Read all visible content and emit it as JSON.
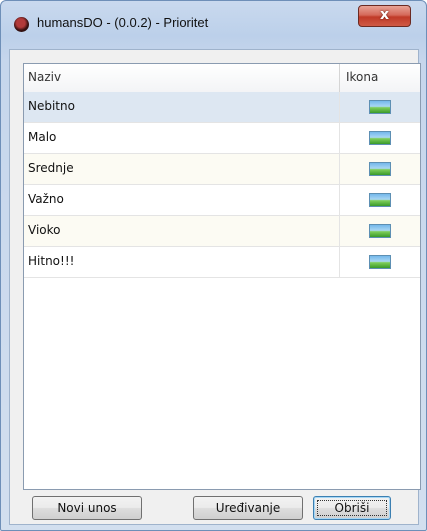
{
  "window": {
    "title": "humansDO - (0.0.2) - Prioritet",
    "close_label": "x"
  },
  "grid": {
    "columns": [
      "Naziv",
      "Ikona"
    ],
    "rows": [
      {
        "name": "Nebitno",
        "icon": "image-icon",
        "selected": true
      },
      {
        "name": "Malo",
        "icon": "image-icon"
      },
      {
        "name": "Srednje",
        "icon": "image-icon"
      },
      {
        "name": "Važno",
        "icon": "image-icon"
      },
      {
        "name": "Vioko",
        "icon": "image-icon"
      },
      {
        "name": "Hitno!!!",
        "icon": "image-icon"
      }
    ]
  },
  "buttons": {
    "new": "Novi unos",
    "edit": "Uređivanje",
    "delete": "Obriši"
  },
  "colors": {
    "selection": "#dde7f2",
    "close_button": "#c03a28"
  }
}
